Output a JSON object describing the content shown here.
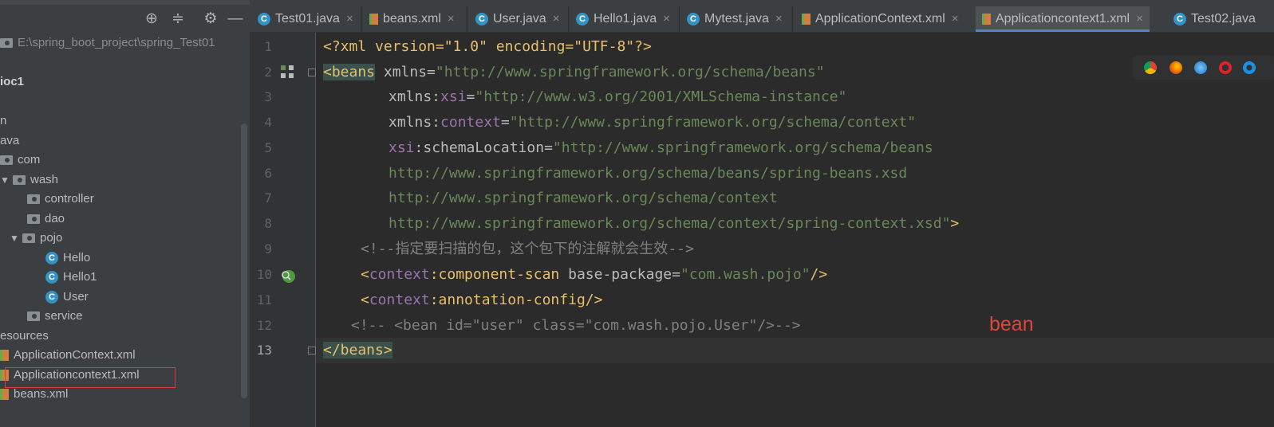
{
  "project_panel": {
    "path_text": "E:\\spring_boot_project\\spring_Test01",
    "module_label": "ioc1",
    "tree": [
      {
        "label": "n",
        "kind": "folder-partial"
      },
      {
        "label": "ava",
        "kind": "folder-partial"
      },
      {
        "label": "com",
        "kind": "folder"
      },
      {
        "label": "wash",
        "kind": "folder"
      },
      {
        "label": "controller",
        "kind": "folder"
      },
      {
        "label": "dao",
        "kind": "folder"
      },
      {
        "label": "pojo",
        "kind": "folder"
      },
      {
        "label": "Hello",
        "kind": "class"
      },
      {
        "label": "Hello1",
        "kind": "class"
      },
      {
        "label": "User",
        "kind": "class"
      },
      {
        "label": "service",
        "kind": "folder"
      },
      {
        "label": "esources",
        "kind": "folder-partial"
      },
      {
        "label": "ApplicationContext.xml",
        "kind": "xml"
      },
      {
        "label": "Applicationcontext1.xml",
        "kind": "xml",
        "selected": true
      },
      {
        "label": "beans.xml",
        "kind": "xml"
      }
    ],
    "highlight_color": "#e03a3a"
  },
  "tabs": [
    {
      "label": "Test01.java",
      "icon": "class-icon"
    },
    {
      "label": "beans.xml",
      "icon": "xml-file-icon"
    },
    {
      "label": "User.java",
      "icon": "class-icon"
    },
    {
      "label": "Hello1.java",
      "icon": "class-icon"
    },
    {
      "label": "Mytest.java",
      "icon": "class-icon"
    },
    {
      "label": "ApplicationContext.xml",
      "icon": "xml-file-icon"
    },
    {
      "label": "Applicationcontext1.xml",
      "icon": "xml-file-icon",
      "active": true
    },
    {
      "label": "Test02.java",
      "icon": "class-icon"
    }
  ],
  "editor": {
    "line_numbers": [
      "1",
      "2",
      "3",
      "4",
      "5",
      "6",
      "7",
      "8",
      "9",
      "10",
      "11",
      "12",
      "13"
    ],
    "current_line": "13",
    "lines": {
      "l1": {
        "a": "<?xml version=\"1.0\" encoding=\"UTF-8\"?>"
      },
      "l2": {
        "tag": "<beans",
        "attr": " xmlns=",
        "val": "\"http://www.springframework.org/schema/beans\""
      },
      "l3": {
        "a": "xmlns:",
        "ns": "xsi",
        "b": "=",
        "val": "\"http://www.w3.org/2001/XMLSchema-instance\""
      },
      "l4": {
        "a": "xmlns:",
        "ns": "context",
        "b": "=",
        "val": "\"http://www.springframework.org/schema/context\""
      },
      "l5": {
        "ns": "xsi",
        "a": ":schemaLocation=",
        "val": "\"http://www.springframework.org/schema/beans"
      },
      "l6": {
        "val": "http://www.springframework.org/schema/beans/spring-beans.xsd"
      },
      "l7": {
        "val": "http://www.springframework.org/schema/context"
      },
      "l8": {
        "val": "http://www.springframework.org/schema/context/spring-context.xsd\"",
        "end": ">"
      },
      "l9": {
        "cmt": "<!--指定要扫描的包，这个包下的注解就会生效-->"
      },
      "l10": {
        "open": "<",
        "ns": "context",
        "colon": ":",
        "tag": "component-scan",
        "attr": " base-package=",
        "val": "\"com.wash.pojo\"",
        "end": "/>"
      },
      "l11": {
        "open": "<",
        "ns": "context",
        "colon": ":",
        "tag": "annotation-config/>"
      },
      "l12": {
        "cmt": "<!-- <bean id=\"user\" class=\"com.wash.pojo.User\"/>-->"
      },
      "l13": {
        "tag": "</beans>"
      }
    }
  },
  "annotation": {
    "text": "bean",
    "color": "#e0463c"
  },
  "browser_icons": [
    "chrome-icon",
    "firefox-icon",
    "safari-icon",
    "opera-icon",
    "ie-icon"
  ]
}
